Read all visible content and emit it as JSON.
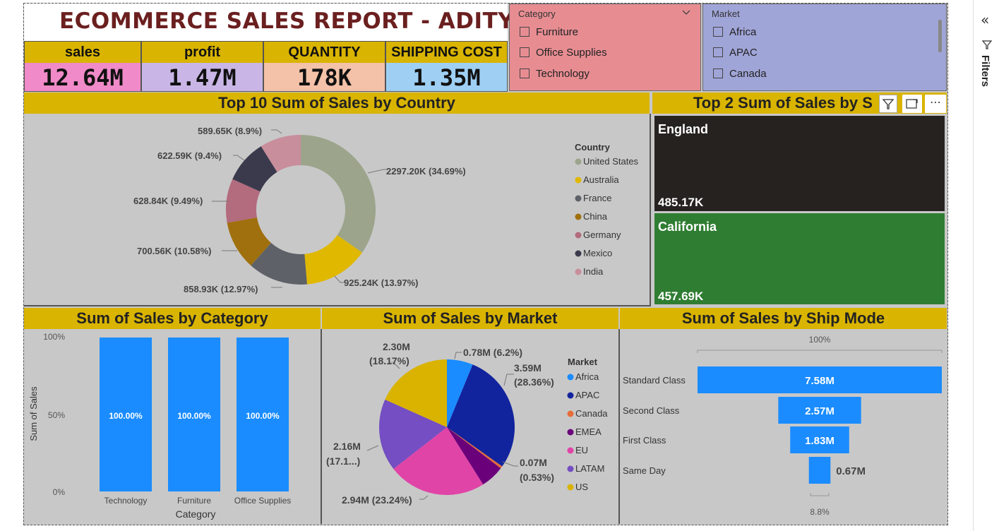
{
  "header": {
    "title": "ECOMMERCE SALES REPORT - ADITYA"
  },
  "kpis": [
    {
      "label": "sales",
      "value": "12.64M",
      "color": "#f08ac8"
    },
    {
      "label": "profit",
      "value": "1.47M",
      "color": "#c9b6e6"
    },
    {
      "label": "QUANTITY",
      "value": "178K",
      "color": "#f3c2a8"
    },
    {
      "label": "SHIPPING COST",
      "value": "1.35M",
      "color": "#9fd0f4"
    }
  ],
  "category_slicer": {
    "title": "Category",
    "items": [
      "Furniture",
      "Office Supplies",
      "Technology"
    ],
    "bg": "#e78d92"
  },
  "market_slicer": {
    "title": "Market",
    "items": [
      "Africa",
      "APAC",
      "Canada"
    ],
    "bg": "#a0a5d8"
  },
  "country_chart": {
    "title": "Top 10 Sum of Sales by Country",
    "legend_title": "Country",
    "data_labels": [
      "2297.20K (34.69%)",
      "925.24K (13.97%)",
      "858.93K (12.97%)",
      "700.56K (10.58%)",
      "628.84K (9.49%)",
      "622.59K (9.4%)",
      "589.65K (8.9%)"
    ]
  },
  "state_chart": {
    "title": "Top 2 Sum of Sales by S",
    "tiles": [
      {
        "name": "England",
        "value": "485.17K",
        "color": "#252220"
      },
      {
        "name": "California",
        "value": "457.69K",
        "color": "#2f7d32"
      }
    ]
  },
  "category_chart": {
    "title": "Sum of Sales by Category",
    "xlabel": "Category",
    "ylabel": "Sum of Sales",
    "yticks": [
      "100%",
      "50%",
      "0%"
    ]
  },
  "market_chart": {
    "title": "Sum of Sales by Market",
    "legend_title": "Market",
    "labels": {
      "africa": "0.78M (6.2%)",
      "apac_v": "3.59M",
      "apac_p": "(28.36%)",
      "canada_v": "0.07M",
      "canada_p": "(0.53%)",
      "eu": "2.94M (23.24%)",
      "latam_v": "2.16M",
      "latam_p": "(17.1...)",
      "us_v": "2.30M",
      "us_p": "(18.17%)"
    }
  },
  "shipmode_chart": {
    "title": "Sum of Sales by Ship Mode",
    "top_label": "100%",
    "bottom_label": "8.8%"
  },
  "filters_pane": {
    "label": "Filters"
  },
  "chart_data": [
    {
      "type": "pie",
      "title": "Top 10 Sum of Sales by Country",
      "categories": [
        "United States",
        "Australia",
        "France",
        "China",
        "Germany",
        "Mexico",
        "India"
      ],
      "values": [
        2297.2,
        925.24,
        858.93,
        700.56,
        628.84,
        622.59,
        589.65
      ],
      "percent": [
        34.69,
        13.97,
        12.97,
        10.58,
        9.49,
        9.4,
        8.9
      ],
      "colors": [
        "#9ca58c",
        "#e0b800",
        "#5e6168",
        "#a0700e",
        "#b36b7e",
        "#3b3a4c",
        "#c88e9c"
      ],
      "legend": "right"
    },
    {
      "type": "bar",
      "title": "Top 2 Sum of Sales by S",
      "categories": [
        "England",
        "California"
      ],
      "values": [
        485.17,
        457.69
      ]
    },
    {
      "type": "bar",
      "title": "Sum of Sales by Category",
      "categories": [
        "Technology",
        "Furniture",
        "Office Supplies"
      ],
      "values": [
        100.0,
        100.0,
        100.0
      ],
      "value_labels": [
        "100.00%",
        "100.00%",
        "100.00%"
      ],
      "xlabel": "Category",
      "ylabel": "Sum of Sales",
      "ylim": [
        0,
        100
      ],
      "color": "#1a8cff"
    },
    {
      "type": "pie",
      "title": "Sum of Sales by Market",
      "categories": [
        "Africa",
        "APAC",
        "Canada",
        "EMEA",
        "EU",
        "LATAM",
        "US"
      ],
      "values": [
        0.78,
        3.59,
        0.07,
        0.71,
        2.94,
        2.16,
        2.3
      ],
      "percent": [
        6.2,
        28.36,
        0.53,
        5.6,
        23.24,
        17.1,
        18.17
      ],
      "colors": [
        "#1a8cff",
        "#12239e",
        "#e66c37",
        "#6b007b",
        "#e044a7",
        "#744ec2",
        "#d9b300"
      ],
      "legend": "right"
    },
    {
      "type": "bar",
      "title": "Sum of Sales by Ship Mode",
      "categories": [
        "Standard Class",
        "Second Class",
        "First Class",
        "Same Day"
      ],
      "values": [
        7.58,
        2.57,
        1.83,
        0.67
      ],
      "value_labels": [
        "7.58M",
        "2.57M",
        "1.83M",
        "0.67M"
      ],
      "color": "#1a8cff"
    }
  ]
}
